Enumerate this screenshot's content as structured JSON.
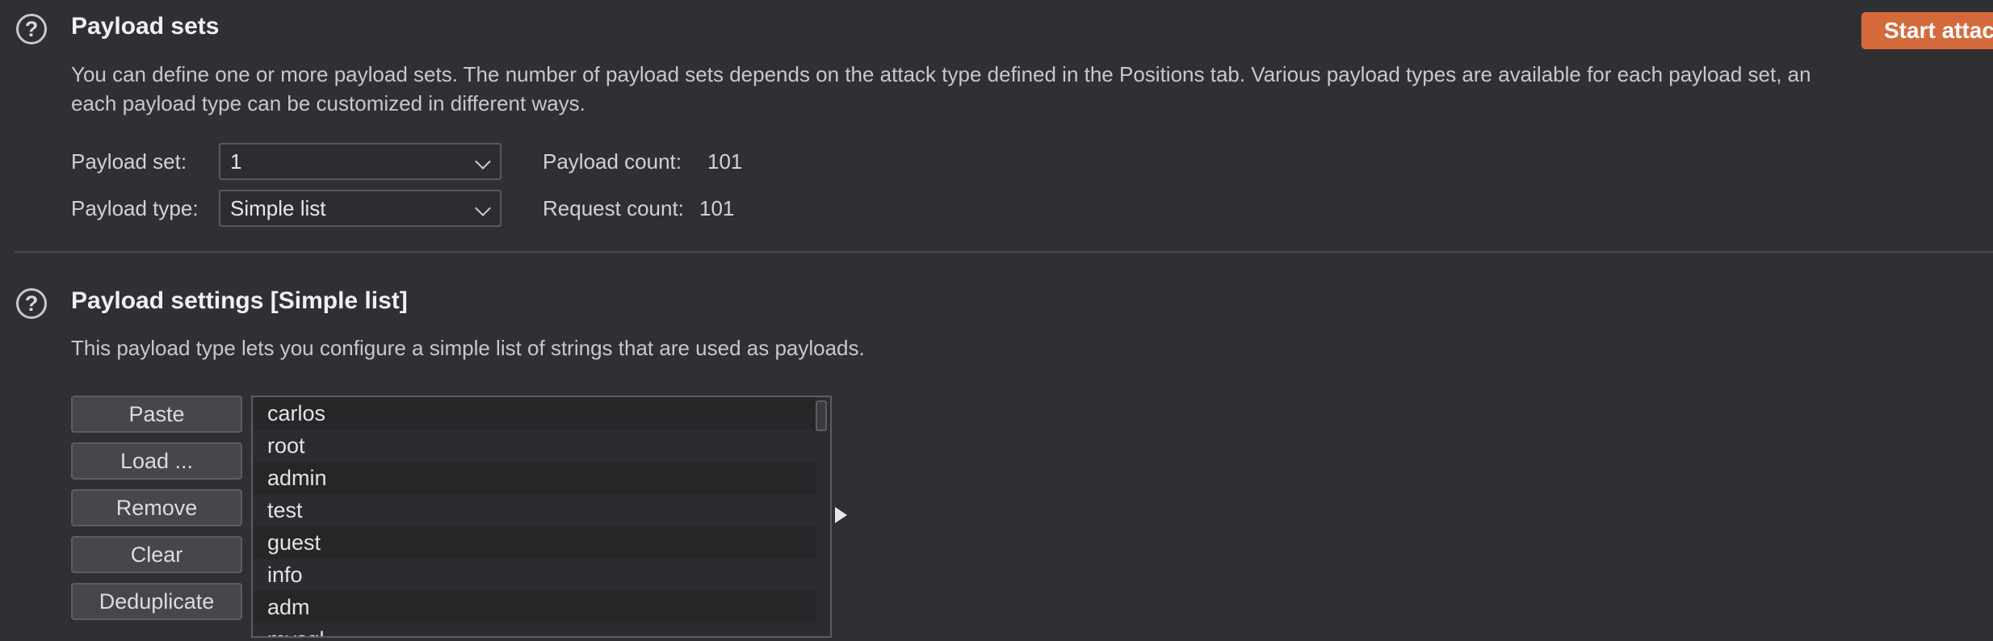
{
  "payload_sets": {
    "help_glyph": "?",
    "title": "Payload sets",
    "start_button": "Start attac",
    "description_line1": "You can define one or more payload sets. The number of payload sets depends on the attack type defined in the Positions tab. Various payload types are available for each payload set, an",
    "description_line2": "each payload type can be customized in different ways.",
    "set_label": "Payload set:",
    "set_value": "1",
    "type_label": "Payload type:",
    "type_value": "Simple list",
    "payload_count_label": "Payload count:",
    "payload_count_value": "101",
    "request_count_label": "Request count:",
    "request_count_value": "101"
  },
  "payload_settings": {
    "help_glyph": "?",
    "title": "Payload settings [Simple list]",
    "description": "This payload type lets you configure a simple list of strings that are used as payloads.",
    "buttons": {
      "paste": "Paste",
      "load": "Load ...",
      "remove": "Remove",
      "clear": "Clear",
      "deduplicate": "Deduplicate"
    },
    "items": [
      "carlos",
      "root",
      "admin",
      "test",
      "guest",
      "info",
      "adm",
      "mysql"
    ]
  },
  "colors": {
    "background": "#2f3033",
    "accent_button": "#d46a3c"
  },
  "icons": {
    "help": "help-circle-icon",
    "dropdown": "chevron-down-icon",
    "expand": "triangle-right-icon"
  }
}
